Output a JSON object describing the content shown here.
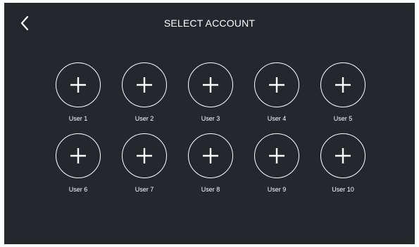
{
  "header": {
    "title": "SELECT ACCOUNT",
    "back_icon": "chevron-left-icon"
  },
  "accounts": [
    {
      "label": "User 1",
      "icon": "plus-icon"
    },
    {
      "label": "User 2",
      "icon": "plus-icon"
    },
    {
      "label": "User 3",
      "icon": "plus-icon"
    },
    {
      "label": "User 4",
      "icon": "plus-icon"
    },
    {
      "label": "User 5",
      "icon": "plus-icon"
    },
    {
      "label": "User 6",
      "icon": "plus-icon"
    },
    {
      "label": "User 7",
      "icon": "plus-icon"
    },
    {
      "label": "User 8",
      "icon": "plus-icon"
    },
    {
      "label": "User 9",
      "icon": "plus-icon"
    },
    {
      "label": "User 10",
      "icon": "plus-icon"
    }
  ],
  "colors": {
    "background": "#24272c",
    "foreground": "#ffffff"
  }
}
